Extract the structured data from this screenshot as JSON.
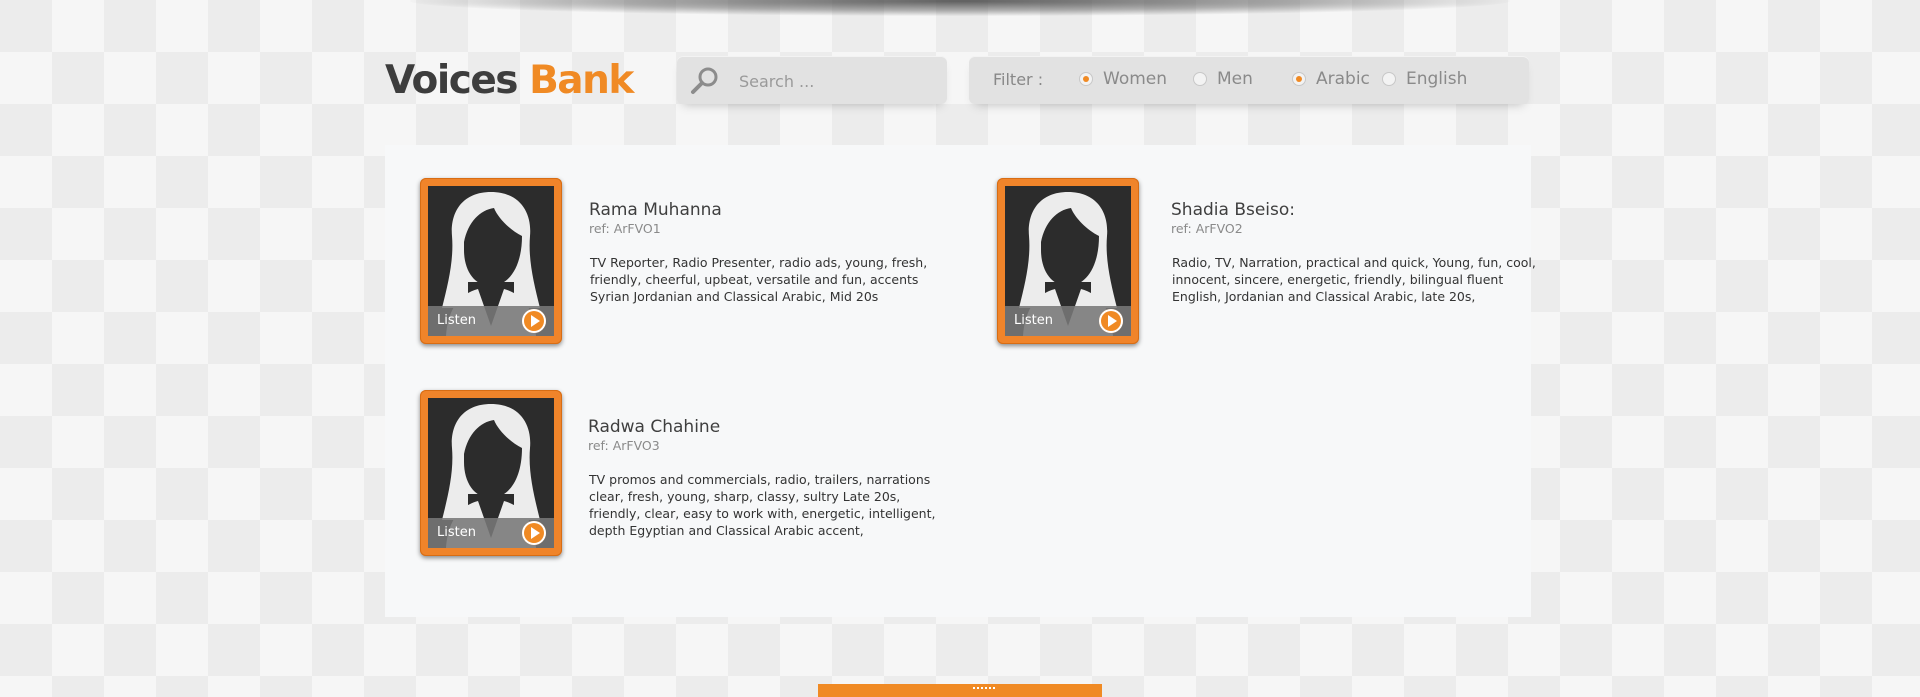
{
  "brand": {
    "word1": "Voices",
    "word2": "Bank"
  },
  "search": {
    "placeholder": "Search ..."
  },
  "filter": {
    "label": "Filter :",
    "options": [
      {
        "label": "Women",
        "checked": true
      },
      {
        "label": "Men",
        "checked": false
      },
      {
        "label": "Arabic",
        "checked": true
      },
      {
        "label": "English",
        "checked": false
      }
    ]
  },
  "voices": [
    {
      "name": "Rama Muhanna",
      "ref": "ref: ArFVO1",
      "listen": "Listen",
      "description_lines": [
        "TV Reporter, Radio Presenter, radio ads, young, fresh,",
        "friendly, cheerful, upbeat, versatile and fun, accents",
        "Syrian Jordanian and Classical Arabic, Mid 20s"
      ]
    },
    {
      "name": "Shadia Bseiso:",
      "ref": "ref: ArFVO2",
      "listen": "Listen",
      "description_lines": [
        "Radio, TV, Narration, practical and quick, Young, fun, cool,",
        "innocent, sincere, energetic, friendly, bilingual fluent",
        "English, Jordanian and Classical Arabic, late 20s,"
      ]
    },
    {
      "name": "Radwa Chahine",
      "ref": "ref: ArFVO3",
      "listen": "Listen",
      "description_lines": [
        "TV promos and commercials, radio, trailers, narrations",
        "clear, fresh, young, sharp, classy, sultry Late 20s,",
        "friendly, clear, easy to work with, energetic, intelligent,",
        "depth Egyptian and Classical Arabic accent,"
      ]
    }
  ],
  "colors": {
    "accent": "#f08a24",
    "text_dark": "#3d3d3d",
    "panel": "#f7f8f9"
  },
  "icons": {
    "search": "magnifier-icon",
    "play": "play-icon",
    "avatar": "female-silhouette-icon"
  }
}
